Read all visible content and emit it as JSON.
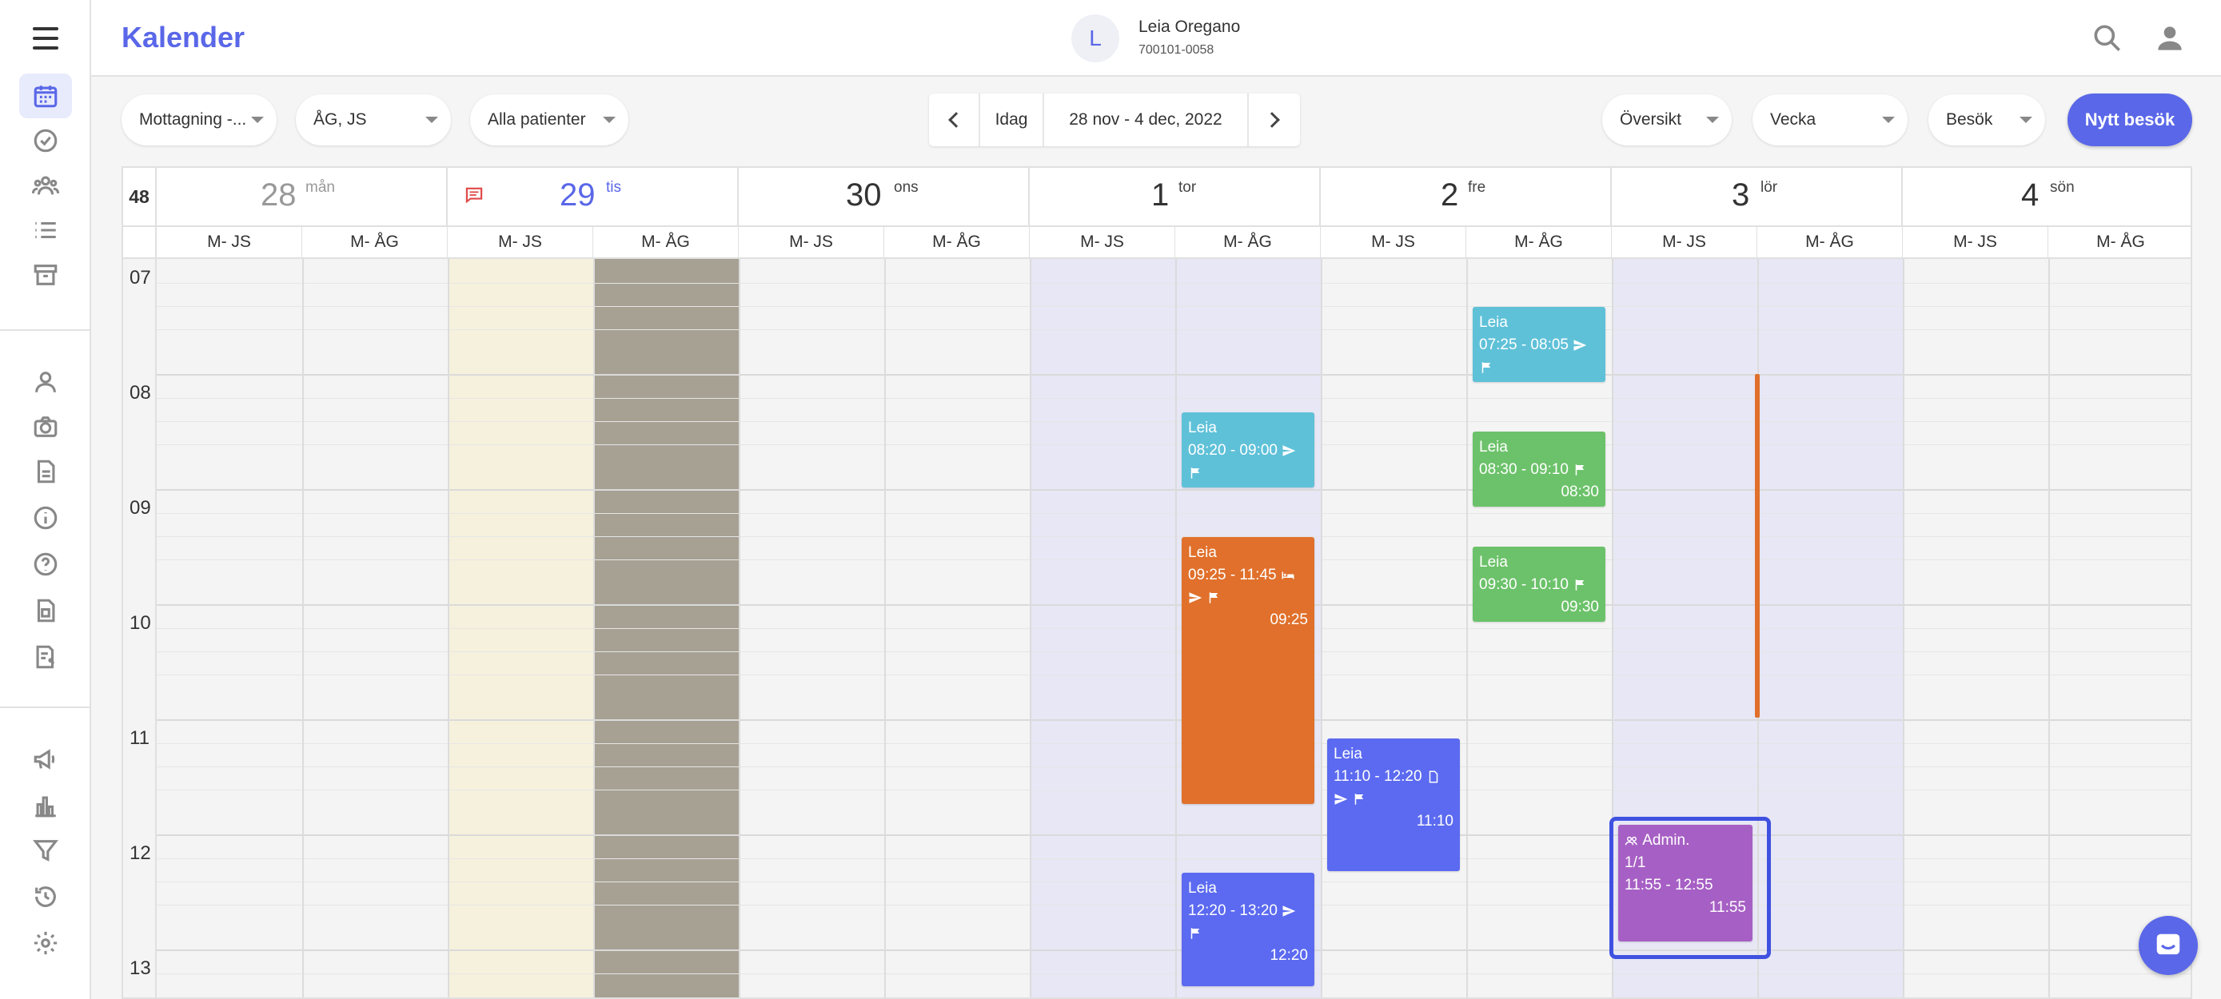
{
  "app": {
    "title": "Kalender"
  },
  "patient": {
    "initial": "L",
    "name": "Leia Oregano",
    "id": "700101-0058"
  },
  "toolbar": {
    "clinic": "Mottagning -...",
    "staff": "ÅG, JS",
    "patients": "Alla patienter",
    "today": "Idag",
    "date_range": "28 nov - 4 dec, 2022",
    "view_mode": "Översikt",
    "period": "Vecka",
    "visit_type": "Besök",
    "new_visit": "Nytt besök"
  },
  "calendar": {
    "week": "48",
    "days": [
      {
        "num": "28",
        "name": "mån"
      },
      {
        "num": "29",
        "name": "tis"
      },
      {
        "num": "30",
        "name": "ons"
      },
      {
        "num": "1",
        "name": "tor"
      },
      {
        "num": "2",
        "name": "fre"
      },
      {
        "num": "3",
        "name": "lör"
      },
      {
        "num": "4",
        "name": "sön"
      }
    ],
    "resources": [
      "M- JS",
      "M- ÅG",
      "M- JS",
      "M- ÅG",
      "M- JS",
      "M- ÅG",
      "M- JS",
      "M- ÅG",
      "M- JS",
      "M- ÅG",
      "M- JS",
      "M- ÅG",
      "M- JS",
      "M- ÅG"
    ],
    "hours": [
      "07",
      "08",
      "09",
      "10",
      "11",
      "12",
      "13"
    ],
    "events": [
      {
        "title": "Leia",
        "time": "07:25 - 08:05",
        "start": ""
      },
      {
        "title": "Leia",
        "time": "08:20 - 09:00",
        "start": ""
      },
      {
        "title": "Leia",
        "time": "08:30 - 09:10",
        "start": "08:30"
      },
      {
        "title": "Leia",
        "time": "09:25 - 11:45",
        "start": "09:25"
      },
      {
        "title": "Leia",
        "time": "09:30 - 10:10",
        "start": "09:30"
      },
      {
        "title": "Leia",
        "time": "11:10 - 12:20",
        "start": "11:10"
      },
      {
        "title": "Admin.",
        "count": "1/1",
        "time": "11:55 - 12:55",
        "start": "11:55"
      },
      {
        "title": "Leia",
        "time": "12:20 - 13:20",
        "start": "12:20"
      }
    ]
  },
  "colors": {
    "accent": "#5a67e8",
    "event_teal": "#5fc1d8",
    "event_green": "#6cc26a",
    "event_orange": "#e0702b",
    "event_blue": "#5b6af0",
    "event_purple": "#a65fc4",
    "today_comment_icon": "#e04848"
  }
}
